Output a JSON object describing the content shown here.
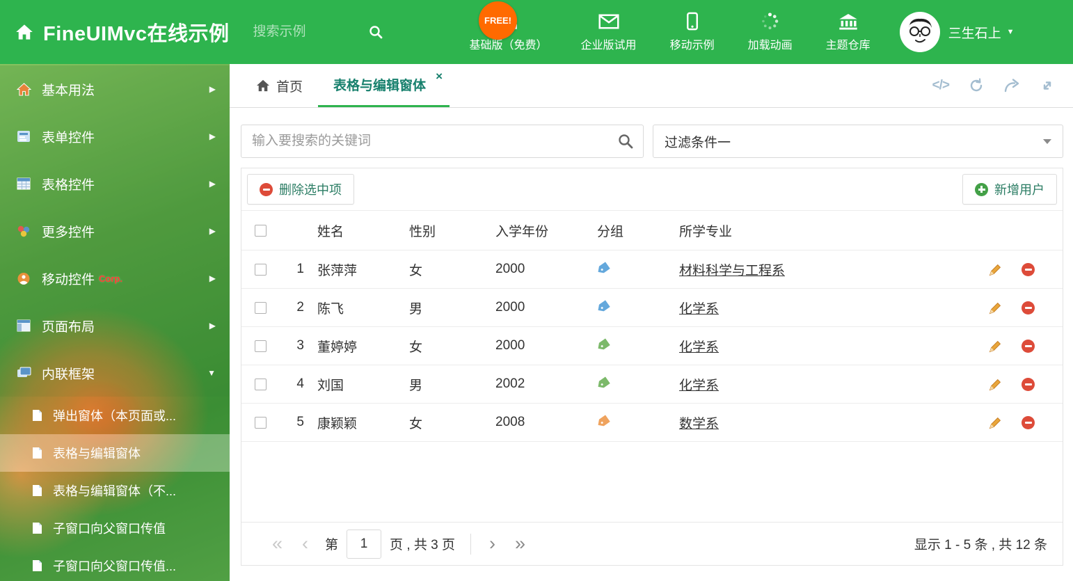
{
  "colors": {
    "header_green": "#2eb44e",
    "active_tab_teal": "#17806d",
    "free_badge_orange": "#ff6a00",
    "delete_red": "#dd4b39",
    "add_green": "#43a047",
    "edit_pencil_orange": "#e9a63a"
  },
  "header": {
    "title": "FineUIMvc在线示例",
    "search_placeholder": "搜索示例",
    "free_badge": "FREE!",
    "nav": [
      {
        "label": "基础版（免费）",
        "icon": "download-icon"
      },
      {
        "label": "企业版试用",
        "icon": "envelope-icon"
      },
      {
        "label": "移动示例",
        "icon": "mobile-icon"
      },
      {
        "label": "加载动画",
        "icon": "spinner-icon"
      },
      {
        "label": "主题仓库",
        "icon": "bank-icon"
      }
    ],
    "user_name": "三生石上"
  },
  "sidebar": {
    "items": [
      {
        "label": "基本用法",
        "icon": "home-icon"
      },
      {
        "label": "表单控件",
        "icon": "form-icon"
      },
      {
        "label": "表格控件",
        "icon": "table-icon"
      },
      {
        "label": "更多控件",
        "icon": "widgets-icon"
      },
      {
        "label": "移动控件",
        "icon": "mobile-icon",
        "badge": "Corp."
      },
      {
        "label": "页面布局",
        "icon": "layout-icon"
      },
      {
        "label": "内联框架",
        "icon": "iframe-icon",
        "expanded": true
      }
    ],
    "subitems": [
      {
        "label": "弹出窗体（本页面或..."
      },
      {
        "label": "表格与编辑窗体",
        "active": true
      },
      {
        "label": "表格与编辑窗体（不..."
      },
      {
        "label": "子窗口向父窗口传值"
      },
      {
        "label": "子窗口向父窗口传值..."
      }
    ]
  },
  "tabs": {
    "home_label": "首页",
    "active_label": "表格与编辑窗体",
    "close_glyph": "×"
  },
  "filters": {
    "search_placeholder": "输入要搜索的关键词",
    "dropdown_value": "过滤条件一"
  },
  "grid": {
    "delete_button_label": "删除选中项",
    "add_button_label": "新增用户",
    "columns": [
      "姓名",
      "性别",
      "入学年份",
      "分组",
      "所学专业"
    ],
    "rows": [
      {
        "num": "1",
        "name": "张萍萍",
        "gender": "女",
        "year": "2000",
        "tag_color": "#64a8dc",
        "major": "材料科学与工程系"
      },
      {
        "num": "2",
        "name": "陈飞",
        "gender": "男",
        "year": "2000",
        "tag_color": "#64a8dc",
        "major": "化学系"
      },
      {
        "num": "3",
        "name": "董婷婷",
        "gender": "女",
        "year": "2000",
        "tag_color": "#7cb96a",
        "major": "化学系"
      },
      {
        "num": "4",
        "name": "刘国",
        "gender": "男",
        "year": "2002",
        "tag_color": "#7cb96a",
        "major": "化学系"
      },
      {
        "num": "5",
        "name": "康颖颖",
        "gender": "女",
        "year": "2008",
        "tag_color": "#efa35e",
        "major": "数学系"
      }
    ],
    "pagination": {
      "prefix": "第",
      "page_value": "1",
      "suffix": "页 , 共 3 页",
      "first": "«",
      "prev": "‹",
      "next": "›",
      "last": "»",
      "summary": "显示 1 - 5 条 , 共 12 条"
    }
  }
}
